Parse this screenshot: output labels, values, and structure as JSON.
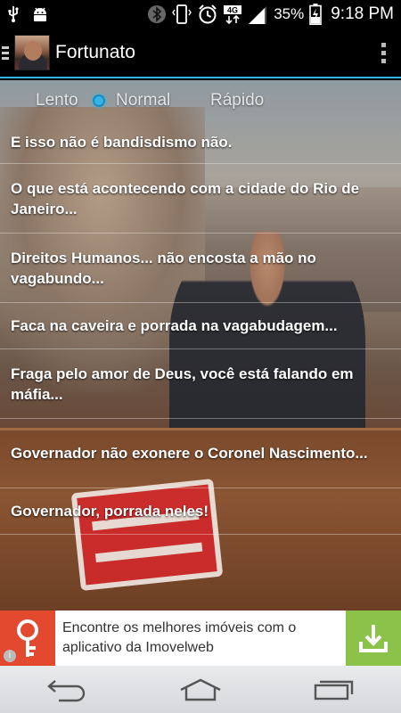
{
  "status_bar": {
    "battery_percent": "35%",
    "time": "9:18 PM",
    "network": "4G",
    "icons": [
      "usb-icon",
      "android-debug-icon",
      "bluetooth-icon",
      "vibrate-icon",
      "alarm-icon",
      "network-4g-icon",
      "signal-icon",
      "battery-charging-icon"
    ]
  },
  "app_bar": {
    "title": "Fortunato",
    "menu_icon": "hamburger-icon",
    "overflow_icon": "overflow-menu-icon"
  },
  "speed": {
    "options": [
      "Lento",
      "Normal",
      "Rápido"
    ],
    "selected": "Normal"
  },
  "phrases": [
    "E isso não é bandisdismo não.",
    "O que está acontecendo com a cidade do Rio de Janeiro...",
    "Direitos Humanos... não encosta a mão no vagabundo...",
    "Faca na caveira e porrada na vagabudagem...",
    "Fraga pelo amor de Deus, você está falando em máfia...",
    "Governador não exonere o Coronel Nascimento...",
    "Governador, porrada neles!"
  ],
  "ad": {
    "text": "Encontre os melhores imóveis com o aplicativo da Imovelweb",
    "info_label": "i",
    "cta_icon": "download-icon"
  },
  "nav": {
    "icons": [
      "back-icon",
      "home-icon",
      "recent-apps-icon"
    ]
  },
  "colors": {
    "accent": "#33b5e5",
    "ad_cta": "#8bc34a",
    "ad_logo": "#e2492f"
  }
}
